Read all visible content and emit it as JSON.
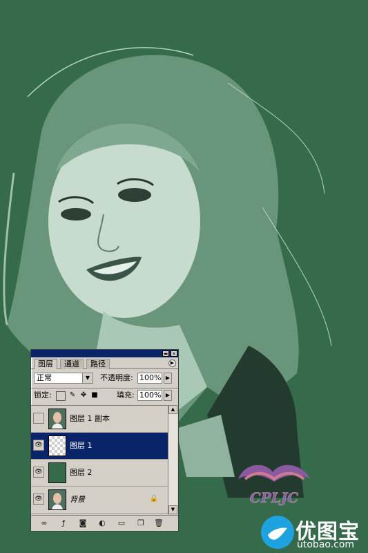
{
  "colors": {
    "background": "#356a4a",
    "selection": "#0a246a",
    "panel": "#d4d0c8"
  },
  "palette": {
    "tabs": [
      "图层",
      "通道",
      "路径"
    ],
    "blend_mode": "正常",
    "opacity_label": "不透明度:",
    "opacity_value": "100%",
    "lock_label": "锁定:",
    "fill_label": "填充:",
    "fill_value": "100%",
    "layers": [
      {
        "name": "图层 1 副本",
        "visible": false,
        "selected": false
      },
      {
        "name": "图层 1",
        "visible": true,
        "selected": true
      },
      {
        "name": "图层 2",
        "visible": true,
        "selected": false
      },
      {
        "name": "背景",
        "visible": true,
        "selected": false,
        "locked": true
      }
    ],
    "bottom_icons": [
      "link-icon",
      "layer-style-icon",
      "mask-icon",
      "adjustment-icon",
      "folder-icon",
      "new-layer-icon",
      "trash-icon"
    ]
  },
  "watermark": {
    "logo_text": "CPLJC",
    "brand_cn": "优图宝",
    "brand_url": "utobao.com"
  }
}
